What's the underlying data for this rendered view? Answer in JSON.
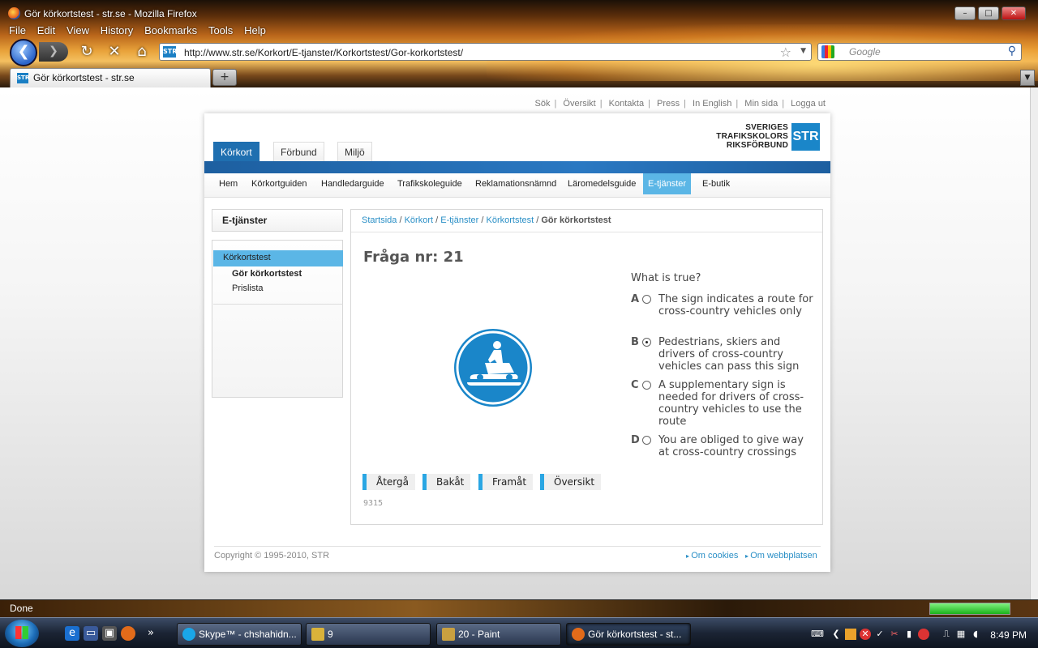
{
  "window": {
    "title": "Gör körkortstest - str.se - Mozilla Firefox"
  },
  "menubar": [
    "File",
    "Edit",
    "View",
    "History",
    "Bookmarks",
    "Tools",
    "Help"
  ],
  "navbar": {
    "url": "http://www.str.se/Korkort/E-tjanster/Korkortstest/Gor-korkortstest/",
    "search_placeholder": "Google"
  },
  "tab": {
    "label": "Gör körkortstest - str.se"
  },
  "toplinks": [
    "Sök",
    "Översikt",
    "Kontakta",
    "Press",
    "In English",
    "Min sida",
    "Logga ut"
  ],
  "logo": {
    "line1": "SVERIGES",
    "line2": "TRAFIKSKOLORS",
    "line3": "RIKSFÖRBUND",
    "mark": "STR"
  },
  "maintabs": [
    "Körkort",
    "Förbund",
    "Miljö"
  ],
  "subnav": [
    "Hem",
    "Körkortguiden",
    "Handledarguide",
    "Trafikskoleguide",
    "Reklamationsnämnd",
    "Läromedelsguide",
    "E-tjänster",
    "E-butik"
  ],
  "sidebar": {
    "title": "E-tjänster",
    "active": "Körkortstest",
    "items": [
      "Gör körkortstest",
      "Prislista"
    ]
  },
  "breadcrumb": {
    "links": [
      "Startsida",
      "Körkort",
      "E-tjänster",
      "Körkortstest"
    ],
    "current": "Gör körkortstest"
  },
  "question": {
    "title": "Fråga nr: 21",
    "text": "What is true?",
    "selected": "B",
    "answers": [
      {
        "letter": "A",
        "text": "The sign indicates a route for cross-country vehicles only"
      },
      {
        "letter": "B",
        "text": "Pedestrians, skiers and drivers of cross-country vehicles can pass this sign"
      },
      {
        "letter": "C",
        "text": "A supplementary sign is needed for drivers of cross-country vehicles to use the route"
      },
      {
        "letter": "D",
        "text": "You are obliged to give way at cross-country crossings"
      }
    ],
    "buttons": [
      "Återgå",
      "Bakåt",
      "Framåt",
      "Översikt"
    ],
    "id": "9315",
    "sign_color": "#1a86c9"
  },
  "footer": {
    "copyright": "Copyright © 1995-2010, STR",
    "links": [
      "Om cookies",
      "Om webbplatsen"
    ]
  },
  "status": {
    "text": "Done",
    "progress": 1.0
  },
  "taskbar": {
    "tasks": [
      "Skype™ - chshahidn...",
      "9",
      "20 - Paint",
      "Gör körkortstest - st..."
    ],
    "clock": "8:49 PM"
  }
}
